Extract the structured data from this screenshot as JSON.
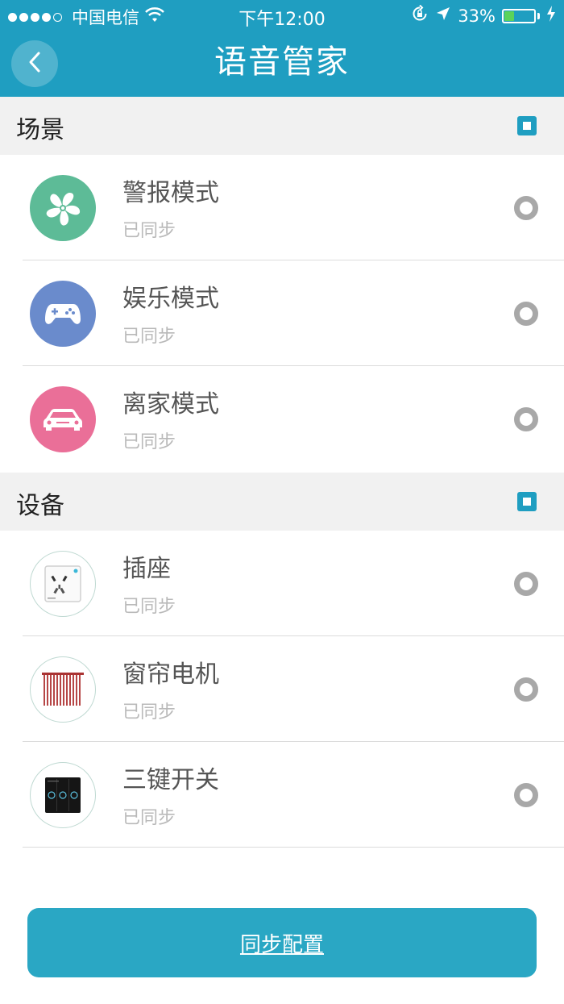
{
  "status_bar": {
    "carrier": "中国电信",
    "time": "下午12:00",
    "battery": "33%",
    "battery_level": 0.33
  },
  "header": {
    "title": "语音管家",
    "back_icon": "chevron-left-icon"
  },
  "sections": [
    {
      "title": "场景",
      "items": [
        {
          "title": "警报模式",
          "status": "已同步",
          "icon": "fan-icon",
          "color": "#5dbb97"
        },
        {
          "title": "娱乐模式",
          "status": "已同步",
          "icon": "gamepad-icon",
          "color": "#6a8bcc"
        },
        {
          "title": "离家模式",
          "status": "已同步",
          "icon": "car-icon",
          "color": "#ea6f98"
        }
      ]
    },
    {
      "title": "设备",
      "items": [
        {
          "title": "插座",
          "status": "已同步",
          "icon": "socket-icon"
        },
        {
          "title": "窗帘电机",
          "status": "已同步",
          "icon": "curtain-icon"
        },
        {
          "title": "三键开关",
          "status": "已同步",
          "icon": "three-key-switch-icon"
        }
      ]
    }
  ],
  "footer": {
    "sync_label": "同步配置"
  },
  "colors": {
    "accent": "#1f9ec1",
    "button": "#2aa7c4"
  }
}
